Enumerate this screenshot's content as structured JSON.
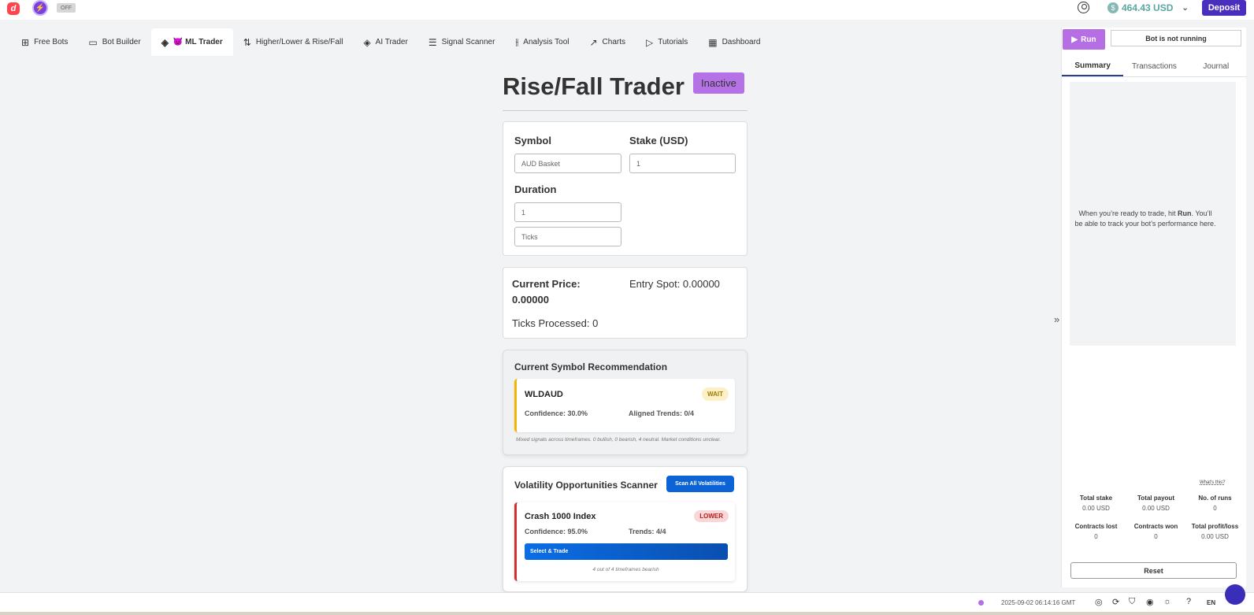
{
  "header": {
    "off_label": "OFF",
    "balance": "464.43 USD",
    "deposit_label": "Deposit"
  },
  "nav": {
    "tabs": [
      {
        "label": "Free Bots",
        "icon": "grid-icon"
      },
      {
        "label": "Bot Builder",
        "icon": "builder-icon"
      },
      {
        "label": "😈 ML Trader",
        "icon": "layers-icon"
      },
      {
        "label": "Higher/Lower & Rise/Fall",
        "icon": "arrows-updown-icon"
      },
      {
        "label": "AI Trader",
        "icon": "layers-icon"
      },
      {
        "label": "Signal Scanner",
        "icon": "list-icon"
      },
      {
        "label": "Analysis Tool",
        "icon": "sliders-icon"
      },
      {
        "label": "Charts",
        "icon": "chart-icon"
      },
      {
        "label": "Tutorials",
        "icon": "play-icon"
      },
      {
        "label": "Dashboard",
        "icon": "dashboard-icon"
      }
    ]
  },
  "main": {
    "title": "Rise/Fall Trader",
    "status": "Inactive",
    "form": {
      "symbol_label": "Symbol",
      "symbol_value": "AUD Basket",
      "stake_label": "Stake (USD)",
      "stake_value": "1",
      "duration_label": "Duration",
      "duration_value": "1",
      "duration_unit": "Ticks"
    },
    "price": {
      "current_label": "Current Price:",
      "current_value": "0.00000",
      "entry_spot": "Entry Spot: 0.00000",
      "ticks_processed": "Ticks Processed: 0"
    },
    "recommendation": {
      "title": "Current Symbol Recommendation",
      "symbol": "WLDAUD",
      "badge": "WAIT",
      "confidence": "Confidence: 30.0%",
      "aligned": "Aligned Trends: 0/4",
      "note": "Mixed signals across timeframes. 0 bullish, 0 bearish, 4 neutral. Market conditions unclear."
    },
    "scanner": {
      "title": "Volatility Opportunities Scanner",
      "scan_button": "Scan All Volatilities",
      "item": {
        "name": "Crash 1000 Index",
        "badge": "LOWER",
        "confidence": "Confidence: 95.0%",
        "trends": "Trends: 4/4",
        "action": "Select & Trade",
        "note": "4 out of 4 timeframes bearish"
      }
    }
  },
  "panel": {
    "run_label": "Run",
    "status": "Bot is not running",
    "tabs": [
      "Summary",
      "Transactions",
      "Journal"
    ],
    "message_pre": "When you’re ready to trade, hit ",
    "message_bold": "Run",
    "message_post": ". You’ll be able to track your bot’s performance here.",
    "whats_this": "What's this?",
    "stats": [
      {
        "label": "Total stake",
        "value": "0.00 USD"
      },
      {
        "label": "Total payout",
        "value": "0.00 USD"
      },
      {
        "label": "No. of runs",
        "value": "0"
      },
      {
        "label": "Contracts lost",
        "value": "0"
      },
      {
        "label": "Contracts won",
        "value": "0"
      },
      {
        "label": "Total profit/loss",
        "value": "0.00 USD"
      }
    ],
    "reset_label": "Reset"
  },
  "footer": {
    "timestamp": "2025-09-02 06:14:16 GMT",
    "language": "EN"
  }
}
